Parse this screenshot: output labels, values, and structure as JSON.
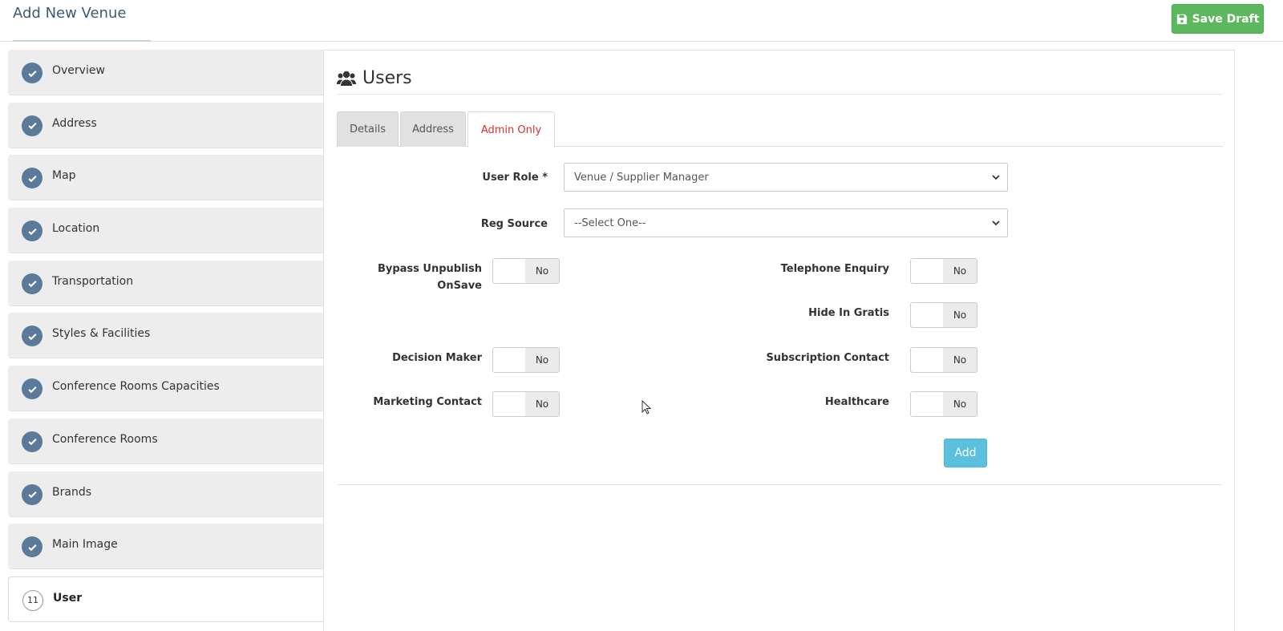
{
  "header": {
    "title": "Add New Venue",
    "save_draft_label": "Save Draft"
  },
  "sidebar": {
    "items": [
      {
        "label": "Overview",
        "icon": "check-icon"
      },
      {
        "label": "Address",
        "icon": "check-icon"
      },
      {
        "label": "Map",
        "icon": "check-icon"
      },
      {
        "label": "Location",
        "icon": "check-icon"
      },
      {
        "label": "Transportation",
        "icon": "check-icon"
      },
      {
        "label": "Styles & Facilities",
        "icon": "check-icon"
      },
      {
        "label": "Conference Rooms Capacities",
        "icon": "check-icon"
      },
      {
        "label": "Conference Rooms",
        "icon": "check-icon"
      },
      {
        "label": "Brands",
        "icon": "check-icon"
      },
      {
        "label": "Main Image",
        "icon": "check-icon"
      }
    ],
    "active": {
      "step": "11",
      "label": "User"
    }
  },
  "panel": {
    "title": "Users",
    "title_icon": "users-icon",
    "tabs": [
      {
        "label": "Details"
      },
      {
        "label": "Address"
      },
      {
        "label": "Admin Only"
      }
    ]
  },
  "form": {
    "user_role": {
      "label": "User Role *",
      "value": "Venue / Supplier Manager"
    },
    "reg_source": {
      "label": "Reg Source",
      "value": "--Select One--"
    },
    "toggles": {
      "bypass_unpublish": {
        "label_line1": "Bypass Unpublish",
        "label_line2": "OnSave",
        "value": "No"
      },
      "telephone_enquiry": {
        "label": "Telephone Enquiry",
        "value": "No"
      },
      "hide_in_gratis": {
        "label": "Hide In Gratis",
        "value": "No"
      },
      "decision_maker": {
        "label": "Decision Maker",
        "value": "No"
      },
      "subscription_contact": {
        "label": "Subscription Contact",
        "value": "No"
      },
      "marketing_contact": {
        "label": "Marketing Contact",
        "value": "No"
      },
      "healthcare": {
        "label": "Healthcare",
        "value": "No"
      }
    },
    "add_label": "Add"
  },
  "colors": {
    "save_green": "#5cb85c",
    "check_blue": "#5b7a99",
    "active_tab_red": "#d9302c",
    "add_blue": "#5bc0de"
  }
}
